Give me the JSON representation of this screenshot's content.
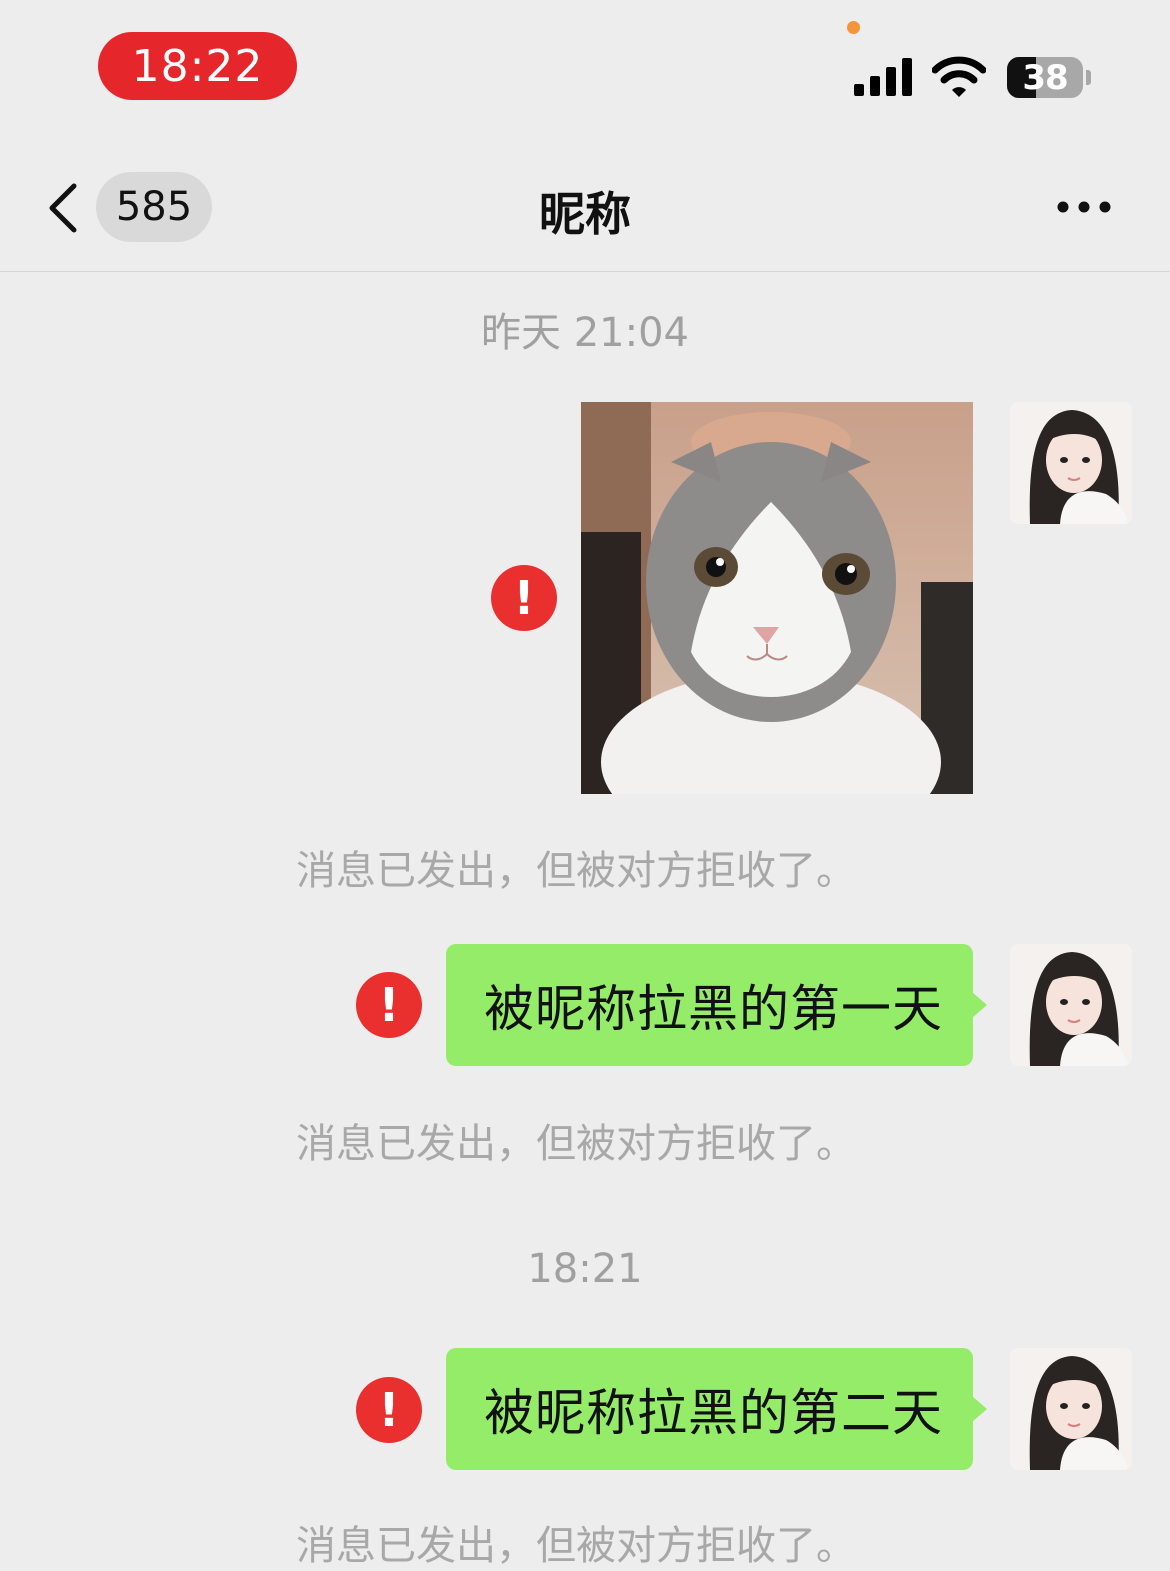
{
  "status_bar": {
    "time": "18:22",
    "battery": "38",
    "battery_level": 0.38,
    "icons": [
      "signal-icon",
      "wifi-icon",
      "battery-icon"
    ]
  },
  "nav": {
    "back_count": "585",
    "title": "昵称",
    "icons": [
      "back-chevron-icon",
      "more-icon"
    ]
  },
  "chat": {
    "timestamps": [
      "昨天 21:04",
      "18:21"
    ],
    "messages": [
      {
        "type": "image",
        "image": "cat-photo",
        "status": "error",
        "note": "消息已发出，但被对方拒收了。"
      },
      {
        "type": "text",
        "text": "被昵称拉黑的第一天",
        "status": "error",
        "note": "消息已发出，但被对方拒收了。"
      },
      {
        "type": "text",
        "text": "被昵称拉黑的第二天",
        "status": "error",
        "note": "消息已发出，但被对方拒收了。"
      }
    ],
    "error_glyph": "!",
    "colors": {
      "background": "#ededed",
      "bubble": "#95ec69",
      "error": "#ea2f2f",
      "time_pill": "#e5262a"
    }
  }
}
